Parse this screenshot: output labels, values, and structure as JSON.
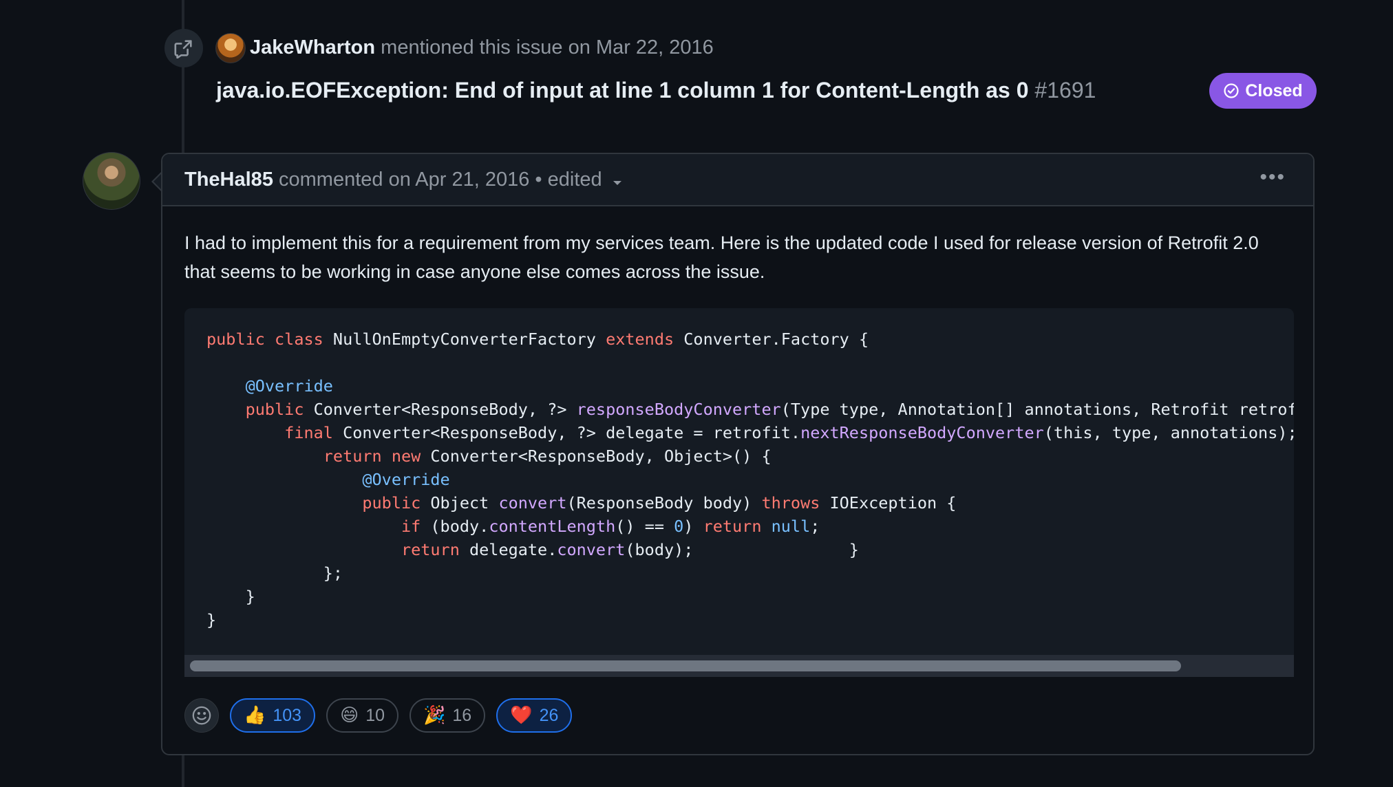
{
  "mention": {
    "author": "JakeWharton",
    "action_text": " mentioned this issue on Mar 22, 2016"
  },
  "issue": {
    "title": "java.io.EOFException: End of input at line 1 column 1 for Content-Length as 0",
    "number": " #1691",
    "status": "Closed"
  },
  "comment": {
    "author": "TheHal85",
    "meta": " commented on Apr 21, 2016 • edited",
    "menu_label": "•••",
    "body": "I had to implement this for a requirement from my services team. Here is the updated code I used for release version of Retrofit 2.0 that seems to be working in case anyone else comes across the issue."
  },
  "code": {
    "l1_kw": "public class",
    "l1_a": " NullOnEmptyConverterFactory ",
    "l1_kw2": "extends",
    "l1_b": " Converter.Factory {",
    "l3_an": "@Override",
    "l4_kw": "public",
    "l4_a": " Converter<ResponseBody, ?> ",
    "l4_fn": "responseBodyConverter",
    "l4_b": "(Type type, Annotation[] annotations, Retrofit retrofit) {",
    "l5_kw": "final",
    "l5_a": " Converter<ResponseBody, ?> delegate = retrofit.",
    "l5_fn": "nextResponseBodyConverter",
    "l5_b": "(this, type, annotations);",
    "l6_kw": "return new",
    "l6_a": " Converter<ResponseBody, Object>() {",
    "l7_an": "@Override",
    "l8_kw": "public",
    "l8_a": " Object ",
    "l8_fn": "convert",
    "l8_b": "(ResponseBody body) ",
    "l8_kw2": "throws",
    "l8_c": " IOException {",
    "l9_kw": "if",
    "l9_a": " (body.",
    "l9_fn": "contentLength",
    "l9_b": "() == ",
    "l9_num": "0",
    "l9_c": ") ",
    "l9_kw2": "return",
    "l9_d": " ",
    "l9_null": "null",
    "l9_e": ";",
    "l10_kw": "return",
    "l10_a": " delegate.",
    "l10_fn": "convert",
    "l10_b": "(body);                }",
    "l11": "};",
    "l12": "}",
    "l13": "}"
  },
  "reactions": [
    {
      "emoji": "👍",
      "count": "103",
      "active": true
    },
    {
      "emoji": "😄",
      "count": "10",
      "active": false
    },
    {
      "emoji": "🎉",
      "count": "16",
      "active": false
    },
    {
      "emoji": "❤️",
      "count": "26",
      "active": true
    }
  ],
  "colors": {
    "background": "#0d1117",
    "closed_badge": "#8957e5",
    "keyword": "#ff7b72",
    "function": "#d2a8ff",
    "annotation": "#79c0ff",
    "active_reaction": "#4493f8"
  }
}
